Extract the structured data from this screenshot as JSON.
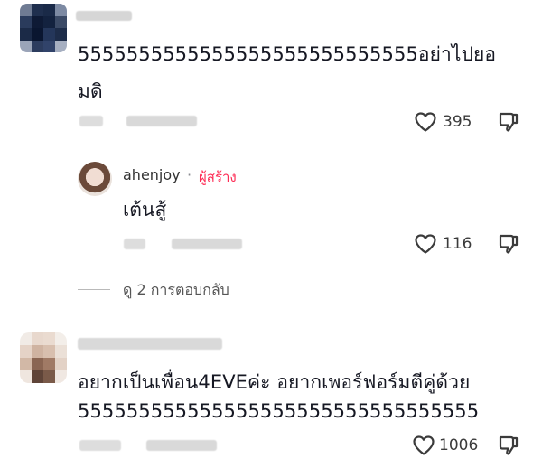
{
  "comments": [
    {
      "text_line1": "5555555555555555555555555555อย่าไปยอ",
      "text_line2": "มดิ",
      "like_count": "395"
    },
    {
      "author": "ahenjoy",
      "separator": "·",
      "badge": "ผู้สร้าง",
      "text": "เต้นสู้",
      "like_count": "116"
    },
    {
      "text_line1": "อยากเป็นเพื่อน4EVEค่ะ อยากเพอร์ฟอร์มตีคู่ด้วย",
      "text_line2": "555555555555555555555555555555555",
      "like_count": "1006"
    }
  ],
  "view_replies": {
    "label": "ดู 2 การตอบกลับ"
  },
  "icons": {
    "like": "heart-outline-icon",
    "dislike": "thumbs-down-icon"
  }
}
